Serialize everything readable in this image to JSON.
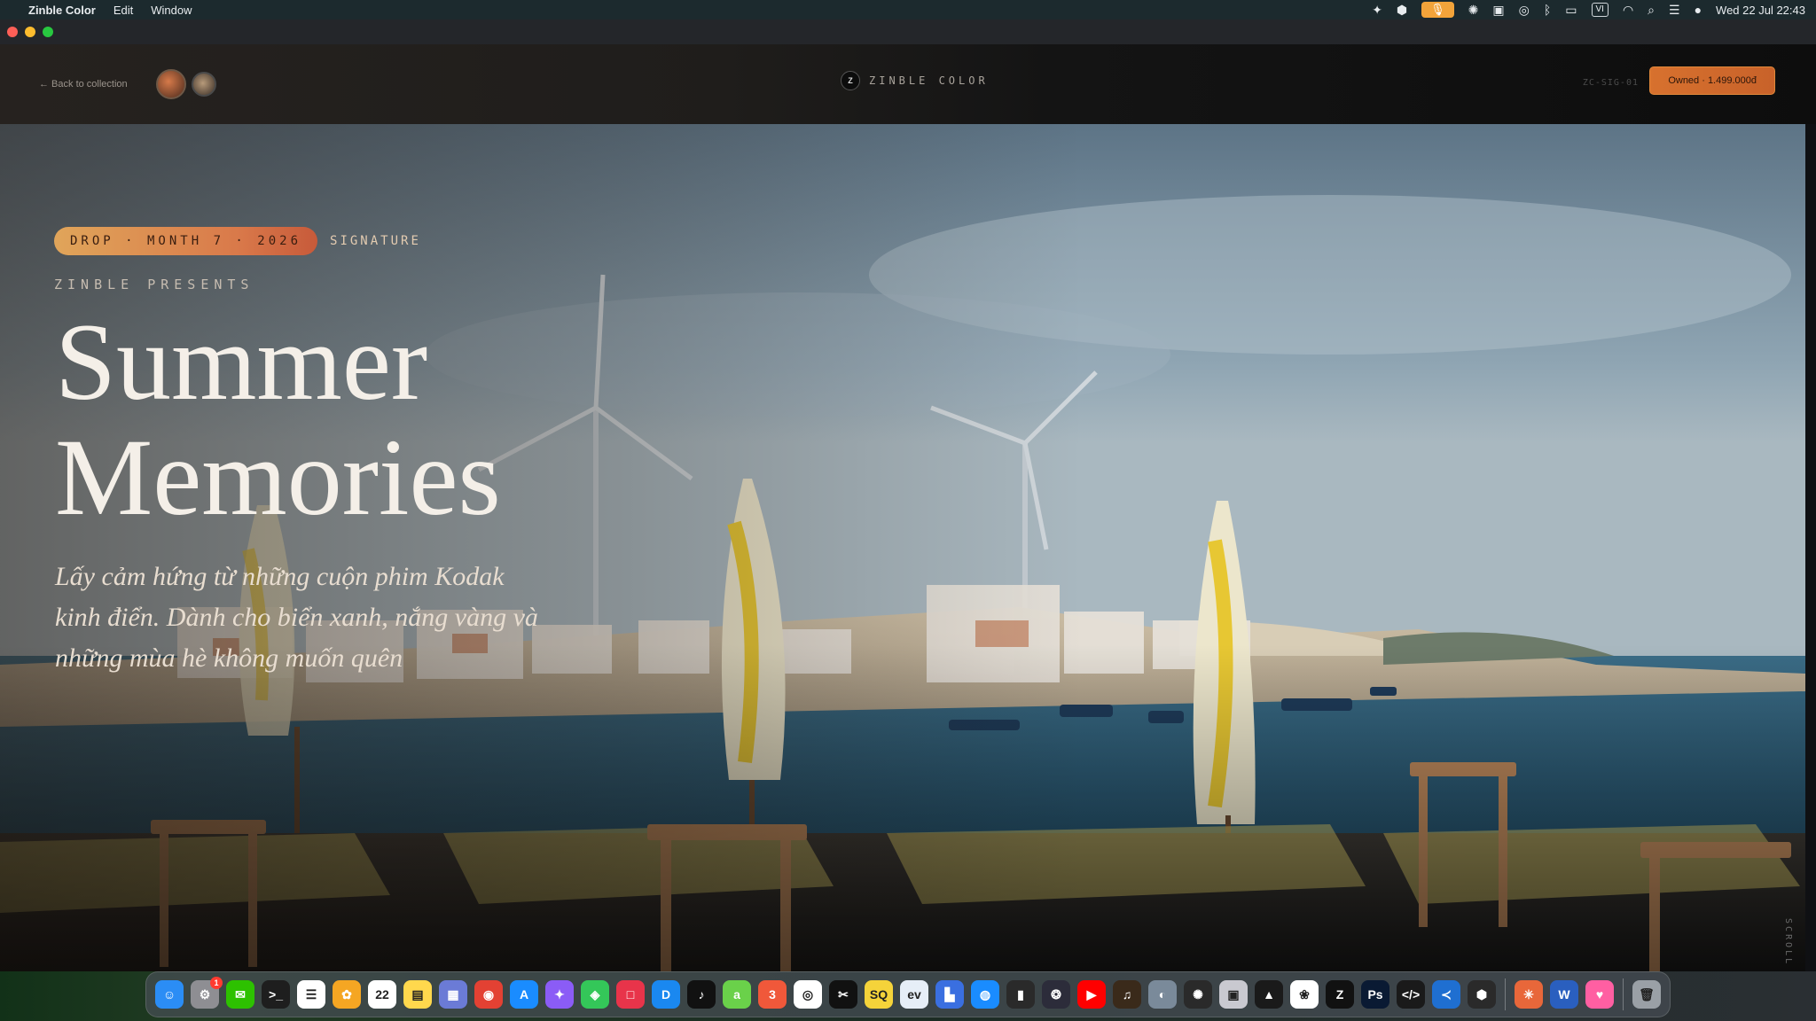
{
  "menubar": {
    "app_name": "Zinble Color",
    "menus": [
      "Edit",
      "Window"
    ],
    "vi_label": "VI",
    "clock": "Wed 22 Jul  22:43"
  },
  "navbar": {
    "back_label": "← Back to collection",
    "brand_mark": "Z",
    "brand_text": "ZINBLE COLOR",
    "sku": "ZC-SIG-01",
    "owned_label": "Owned · 1.499.000đ"
  },
  "hero": {
    "drop_label": "DROP · MONTH 7 · 2026",
    "signature_label": "SIGNATURE",
    "presents": "ZINBLE PRESENTS",
    "title_line1": "Summer",
    "title_line2": "Memories",
    "subtitle": "Lấy cảm hứng từ những cuộn phim Kodak kinh điển. Dành cho biển xanh, nắng vàng và những mùa hè không muốn quên",
    "scroll_label": "SCROLL D"
  },
  "dock": {
    "calendar_day": "22",
    "badge_count": "1",
    "apps": [
      {
        "name": "finder",
        "color": "#2b8df5",
        "glyph": "☺"
      },
      {
        "name": "system-settings",
        "color": "#8e8e93",
        "glyph": "⚙"
      },
      {
        "name": "wechat",
        "color": "#2dc100",
        "glyph": "✉"
      },
      {
        "name": "terminal",
        "color": "#1e1e1e",
        "glyph": ">_"
      },
      {
        "name": "reminders",
        "color": "#ffffff",
        "glyph": "☰"
      },
      {
        "name": "photos",
        "color": "#f5a623",
        "glyph": "✿"
      },
      {
        "name": "calendar",
        "color": "#ffffff",
        "glyph": "22"
      },
      {
        "name": "notes",
        "color": "#ffd84d",
        "glyph": "▤"
      },
      {
        "name": "launchpad",
        "color": "#6b7bd6",
        "glyph": "▦"
      },
      {
        "name": "chrome",
        "color": "#e34133",
        "glyph": "◉"
      },
      {
        "name": "app-store",
        "color": "#1a8cff",
        "glyph": "A"
      },
      {
        "name": "affinity",
        "color": "#8b5cf6",
        "glyph": "✦"
      },
      {
        "name": "maps",
        "color": "#34c759",
        "glyph": "◈"
      },
      {
        "name": "red-app",
        "color": "#e8344a",
        "glyph": "□"
      },
      {
        "name": "d-app",
        "color": "#1a88f0",
        "glyph": "D"
      },
      {
        "name": "tiktok",
        "color": "#111111",
        "glyph": "♪"
      },
      {
        "name": "green-a",
        "color": "#6ad14a",
        "glyph": "a"
      },
      {
        "name": "3dl",
        "color": "#f0583a",
        "glyph": "3"
      },
      {
        "name": "circle-app",
        "color": "#ffffff",
        "glyph": "◎"
      },
      {
        "name": "capcut",
        "color": "#111111",
        "glyph": "✂"
      },
      {
        "name": "sq",
        "color": "#f5d33a",
        "glyph": "SQ"
      },
      {
        "name": "ev",
        "color": "#e6eef7",
        "glyph": "ev"
      },
      {
        "name": "puzzle",
        "color": "#3a6fe0",
        "glyph": "▙"
      },
      {
        "name": "safari",
        "color": "#1a8cff",
        "glyph": "◍"
      },
      {
        "name": "chart-app",
        "color": "#2a2a2a",
        "glyph": "▮"
      },
      {
        "name": "davinci",
        "color": "#2c2c3a",
        "glyph": "❂"
      },
      {
        "name": "youtube",
        "color": "#ff0000",
        "glyph": "▶"
      },
      {
        "name": "instruments",
        "color": "#3a2a1a",
        "glyph": "♫"
      },
      {
        "name": "disk-utility",
        "color": "#7a8a9a",
        "glyph": "◐"
      },
      {
        "name": "gear-app",
        "color": "#2a2a2a",
        "glyph": "✺"
      },
      {
        "name": "preview",
        "color": "#c9c9d0",
        "glyph": "▣"
      },
      {
        "name": "final-cut",
        "color": "#1a1a1a",
        "glyph": "▲"
      },
      {
        "name": "green-swirl",
        "color": "#ffffff",
        "glyph": "❀"
      },
      {
        "name": "zinble",
        "color": "#111111",
        "glyph": "Z"
      },
      {
        "name": "photoshop",
        "color": "#0a1a33",
        "glyph": "Ps"
      },
      {
        "name": "code-app",
        "color": "#1a1a1a",
        "glyph": "</>"
      },
      {
        "name": "vscode",
        "color": "#1f6fd1",
        "glyph": "≺"
      },
      {
        "name": "box-app",
        "color": "#2a2a2a",
        "glyph": "⬢"
      },
      {
        "name": "claude",
        "color": "#e8673a",
        "glyph": "✳"
      },
      {
        "name": "word",
        "color": "#2a5fbf",
        "glyph": "W"
      },
      {
        "name": "pink-app",
        "color": "#ff5fa2",
        "glyph": "♥"
      },
      {
        "name": "trash",
        "color": "#9aa0a6",
        "glyph": "🗑"
      }
    ]
  }
}
